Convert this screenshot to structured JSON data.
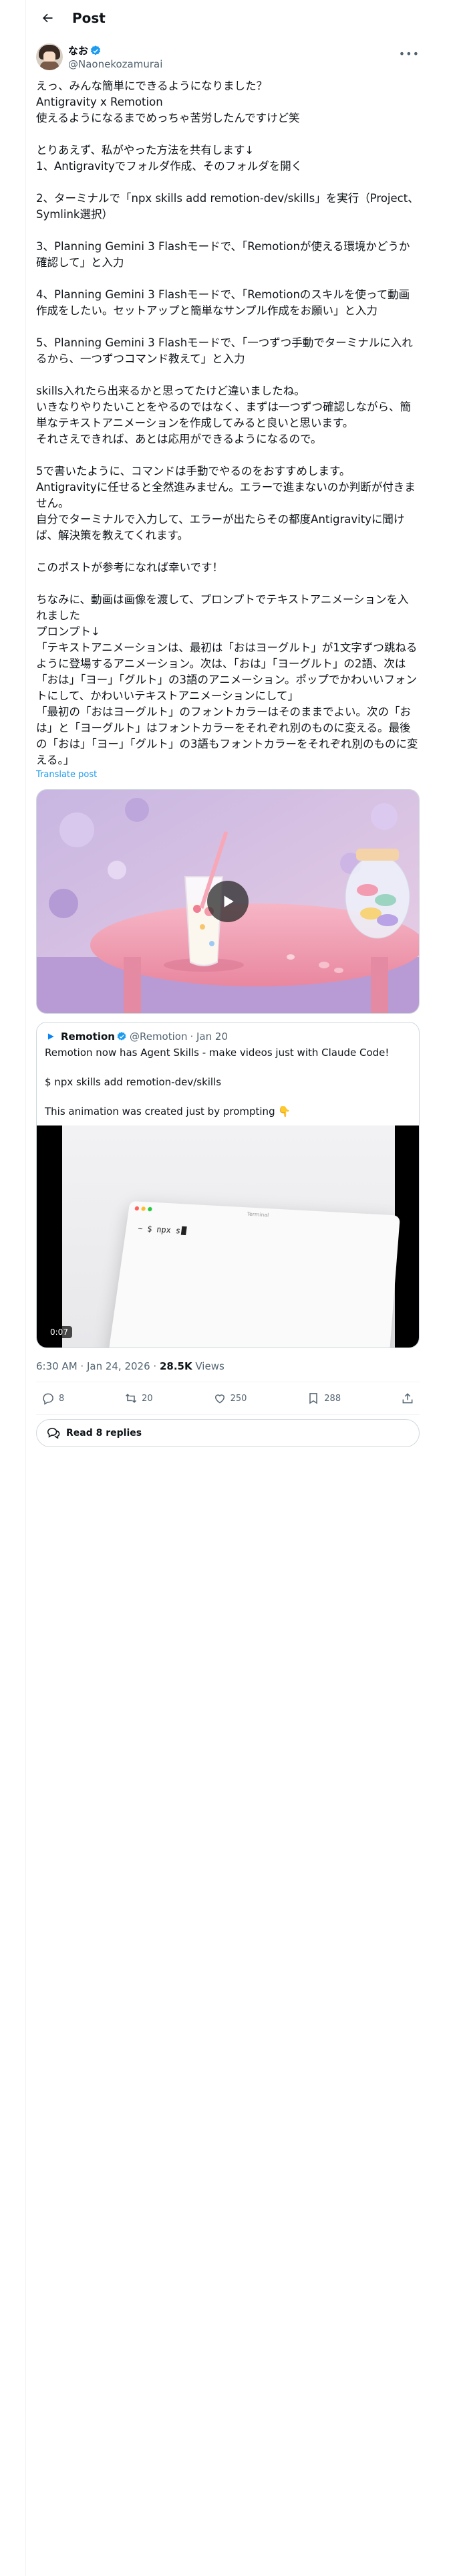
{
  "header": {
    "title": "Post"
  },
  "author": {
    "name": "なお",
    "handle": "@Naonekozamurai"
  },
  "tweet": {
    "text": "えっ、みんな簡単にできるようになりました？\nAntigravity x Remotion\n使えるようになるまでめっちゃ苦労したんですけど笑\n\nとりあえず、私がやった方法を共有します↓\n1、Antigravityでフォルダ作成、そのフォルダを開く\n\n2、ターミナルで「npx skills add remotion-dev/skills」を実行（Project、Symlink選択）\n\n3、Planning Gemini 3 Flashモードで、「Remotionが使える環境かどうか確認して」と入力\n\n4、Planning Gemini 3 Flashモードで、「Remotionのスキルを使って動画作成をしたい。セットアップと簡単なサンプル作成をお願い」と入力\n\n5、Planning Gemini 3 Flashモードで、「一つずつ手動でターミナルに入れるから、一つずつコマンド教えて」と入力\n\nskills入れたら出来るかと思ってたけど違いましたね。\nいきなりやりたいことをやるのではなく、まずは一つずつ確認しながら、簡単なテキストアニメーションを作成してみると良いと思います。\nそれさえできれば、あとは応用ができるようになるので。\n\n5で書いたように、コマンドは手動でやるのをおすすめします。\nAntigravityに任せると全然進みません。エラーで進まないのか判断が付きません。\n自分でターミナルで入力して、エラーが出たらその都度Antigravityに聞けば、解決策を教えてくれます。\n\nこのポストが参考になれば幸いです！\n\nちなみに、動画は画像を渡して、プロンプトでテキストアニメーションを入れました\nプロンプト↓\n「テキストアニメーションは、最初は「おはヨーグルト」が1文字ずつ跳ねるように登場するアニメーション。次は、「おは」「ヨーグルト」の2語、次は「おは」「ヨー」「グルト」の3語のアニメーション。ポップでかわいいフォントにして、かわいいテキストアニメーションにして」\n「最初の「おはヨーグルト」のフォントカラーはそのままでよい。次の「おは」と「ヨーグルト」はフォントカラーをそれぞれ別のものに変える。最後の「おは」「ヨー」「グルト」の3語もフォントカラーをそれぞれ別のものに変える。」",
    "translate_label": "Translate post"
  },
  "quote": {
    "name": "Remotion",
    "handle": "@Remotion",
    "date": "· Jan 20",
    "text": "Remotion now has Agent Skills - make videos just with Claude Code!\n\n$ npx skills add remotion-dev/skills\n\nThis animation was created just by prompting 👇",
    "terminal_title": "Terminal",
    "terminal_line": "~ $ npx  s",
    "duration": "0:07"
  },
  "meta": {
    "time": "6:30 AM · Jan 24, 2026 · ",
    "views_count": "28.5K",
    "views_label": " Views"
  },
  "stats": {
    "replies": "8",
    "reposts": "20",
    "likes": "250",
    "bookmarks": "288"
  },
  "read_replies": "Read 8 replies",
  "colors": {
    "accent": "#1d9bf0",
    "secondary_text": "#536471",
    "border": "#cfd9de"
  }
}
